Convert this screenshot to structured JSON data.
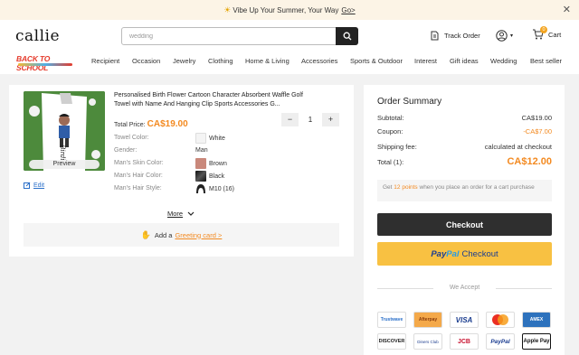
{
  "banner": {
    "text": "Vibe Up Your Summer, Your Way",
    "link": "Go>"
  },
  "header": {
    "logo": "callie",
    "search_placeholder": "wedding",
    "track_order": "Track Order",
    "cart_label": "Cart",
    "cart_count": "0"
  },
  "nav": {
    "promo": "BACK TO SCHOOL",
    "items": [
      "Recipient",
      "Occasion",
      "Jewelry",
      "Clothing",
      "Home & Living",
      "Accessories",
      "Sports & Outdoor",
      "Interest",
      "Gift ideas",
      "Wedding",
      "Best seller"
    ]
  },
  "product": {
    "title": "Personalised Birth Flower Cartoon Character Absorbent Waffle Golf Towel with Name And Hanging Clip Sports Accessories G...",
    "price_label": "Total Price:",
    "price": "CA$19.00",
    "quantity": "1",
    "preview_label": "Preview",
    "edit_label": "Edit",
    "image_script": "Birdie",
    "attributes": [
      {
        "label": "Towel Color:",
        "value": "White",
        "swatch": "#f4f4f4"
      },
      {
        "label": "Gender:",
        "value": "Man",
        "swatch": ""
      },
      {
        "label": "Man's Skin Color:",
        "value": "Brown",
        "swatch": "#c9887b"
      },
      {
        "label": "Man's Hair Color:",
        "value": "Black",
        "swatch": "#1c1c1c"
      },
      {
        "label": "Man's Hair Style:",
        "value": "M10 (16)",
        "swatch": "hair"
      }
    ],
    "more_label": "More",
    "greeting_prefix": "Add a",
    "greeting_link": "Greeting card >"
  },
  "summary": {
    "title": "Order Summary",
    "subtotal_label": "Subtotal:",
    "subtotal": "CA$19.00",
    "coupon_label": "Coupon:",
    "coupon": "-CA$7.00",
    "shipping_label": "Shipping fee:",
    "shipping": "calculated at checkout",
    "total_label": "Total (1):",
    "total": "CA$12.00",
    "points_pre": "Get",
    "points_value": "12 points",
    "points_post": "when you place an order for a cart purchase",
    "checkout_label": "Checkout",
    "paypal_a": "Pay",
    "paypal_b": "Pal",
    "paypal_checkout": "Checkout",
    "we_accept": "We Accept",
    "payments": [
      "Trustwave",
      "Afterpay",
      "VISA",
      "Mastercard",
      "AMEX",
      "DISCOVER",
      "Diners Club",
      "JCB",
      "PayPal",
      "Apple Pay"
    ]
  },
  "colors": {
    "accent": "#f38a21",
    "dark": "#2f2f2f",
    "paypal_yellow": "#f8c142"
  }
}
